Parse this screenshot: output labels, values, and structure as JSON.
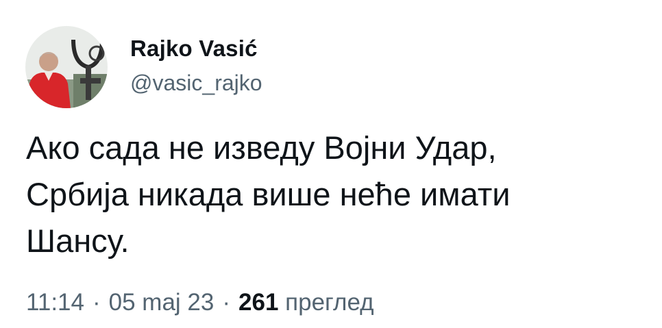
{
  "tweet": {
    "display_name": "Rajko Vasić",
    "handle": "@vasic_rajko",
    "avatar_icon": "user-avatar-photo",
    "text_lines": [
      "Ако сада не изведу Војни Удар,",
      "Србија никада више неће имати",
      "Шансу."
    ],
    "time": "11:14",
    "separator": "·",
    "date": "05 maj 23",
    "views_count": "261",
    "views_label": "преглед"
  },
  "colors": {
    "text_primary": "#0f1419",
    "text_secondary": "#536471",
    "background": "#ffffff"
  }
}
